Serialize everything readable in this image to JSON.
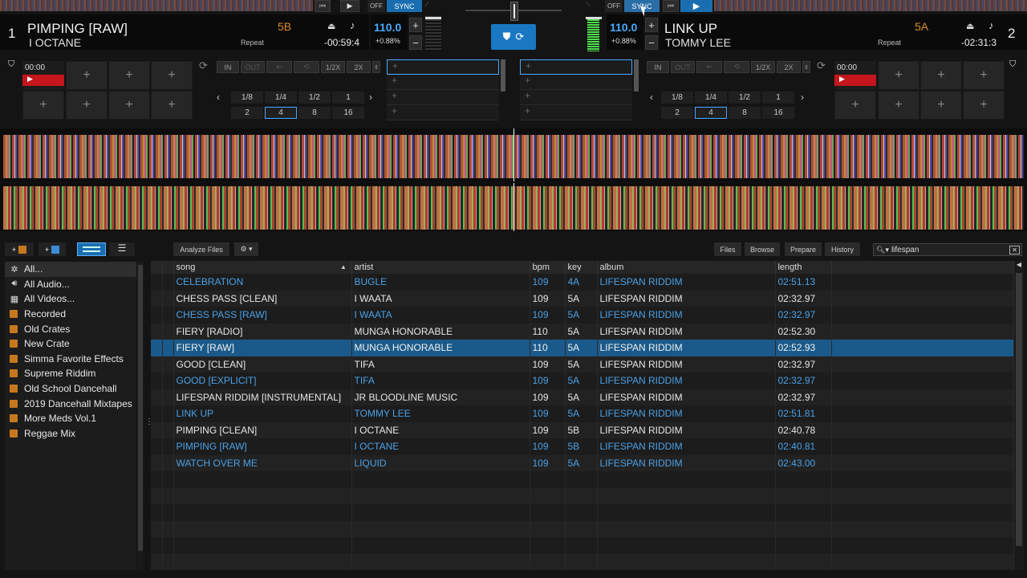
{
  "deck1": {
    "number": "1",
    "title": "PIMPING [RAW]",
    "artist": "I OCTANE",
    "key": "5B",
    "repeat": "Repeat",
    "time": "-00:59:4",
    "bpm": "110.0",
    "pitch": "+0.88%",
    "off": "OFF",
    "sync": "SYNC",
    "cue_time": "00:00"
  },
  "deck2": {
    "number": "2",
    "title": "LINK UP",
    "artist": "TOMMY LEE",
    "key": "5A",
    "repeat": "Repeat",
    "time": "-02:31:3",
    "bpm": "110.0",
    "pitch": "+0.88%",
    "off": "OFF",
    "sync": "SYNC",
    "cue_time": "00:00"
  },
  "loop": {
    "in": "IN",
    "out": "OUT",
    "half": "1/2X",
    "double": "2X",
    "row1": [
      "1/8",
      "1/4",
      "1/2",
      "1"
    ],
    "row2": [
      "2",
      "4",
      "8",
      "16"
    ]
  },
  "toolbar": {
    "analyze": "Analyze Files",
    "files": "Files",
    "browse": "Browse",
    "prepare": "Prepare",
    "history": "History",
    "search_value": "lifespan"
  },
  "sidebar": [
    "All...",
    "All Audio...",
    "All Videos...",
    "Recorded",
    "Old Crates",
    "New Crate",
    "Simma Favorite Effects",
    "Supreme Riddim",
    "Old School Dancehall",
    "2019 Dancehall Mixtapes",
    "More Meds Vol.1",
    "Reggae Mix"
  ],
  "columns": {
    "song": "song",
    "artist": "artist",
    "bpm": "bpm",
    "key": "key",
    "album": "album",
    "length": "length"
  },
  "tracks": [
    {
      "song": "CELEBRATION",
      "artist": "BUGLE",
      "bpm": "109",
      "key": "4A",
      "album": "LIFESPAN RIDDIM",
      "length": "02:51.13",
      "style": "blue"
    },
    {
      "song": "CHESS PASS [CLEAN]",
      "artist": "I WAATA",
      "bpm": "109",
      "key": "5A",
      "album": "LIFESPAN RIDDIM",
      "length": "02:32.97",
      "style": "white"
    },
    {
      "song": "CHESS PASS [RAW]",
      "artist": "I WAATA",
      "bpm": "109",
      "key": "5A",
      "album": "LIFESPAN RIDDIM",
      "length": "02:32.97",
      "style": "blue"
    },
    {
      "song": "FIERY [RADIO]",
      "artist": "MUNGA HONORABLE",
      "bpm": "110",
      "key": "5A",
      "album": "LIFESPAN RIDDIM",
      "length": "02:52.30",
      "style": "white"
    },
    {
      "song": "FIERY [RAW]",
      "artist": "MUNGA HONORABLE",
      "bpm": "110",
      "key": "5A",
      "album": "LIFESPAN RIDDIM",
      "length": "02:52.93",
      "style": "sel"
    },
    {
      "song": "GOOD [CLEAN]",
      "artist": "TIFA",
      "bpm": "109",
      "key": "5A",
      "album": "LIFESPAN RIDDIM",
      "length": "02:32.97",
      "style": "white"
    },
    {
      "song": "GOOD [EXPLICIT]",
      "artist": "TIFA",
      "bpm": "109",
      "key": "5A",
      "album": "LIFESPAN RIDDIM",
      "length": "02:32.97",
      "style": "blue"
    },
    {
      "song": "LIFESPAN RIDDIM [INSTRUMENTAL]",
      "artist": "JR BLOODLINE MUSIC",
      "bpm": "109",
      "key": "5A",
      "album": "LIFESPAN RIDDIM",
      "length": "02:32.97",
      "style": "white"
    },
    {
      "song": "LINK UP",
      "artist": "TOMMY LEE",
      "bpm": "109",
      "key": "5A",
      "album": "LIFESPAN RIDDIM",
      "length": "02:51.81",
      "style": "blue"
    },
    {
      "song": "PIMPING [CLEAN]",
      "artist": "I OCTANE",
      "bpm": "109",
      "key": "5B",
      "album": "LIFESPAN RIDDIM",
      "length": "02:40.78",
      "style": "white"
    },
    {
      "song": "PIMPING [RAW]",
      "artist": "I OCTANE",
      "bpm": "109",
      "key": "5B",
      "album": "LIFESPAN RIDDIM",
      "length": "02:40.81",
      "style": "blue"
    },
    {
      "song": "WATCH OVER ME",
      "artist": "LIQUID",
      "bpm": "109",
      "key": "5A",
      "album": "LIFESPAN RIDDIM",
      "length": "02:43.00",
      "style": "blue"
    }
  ]
}
